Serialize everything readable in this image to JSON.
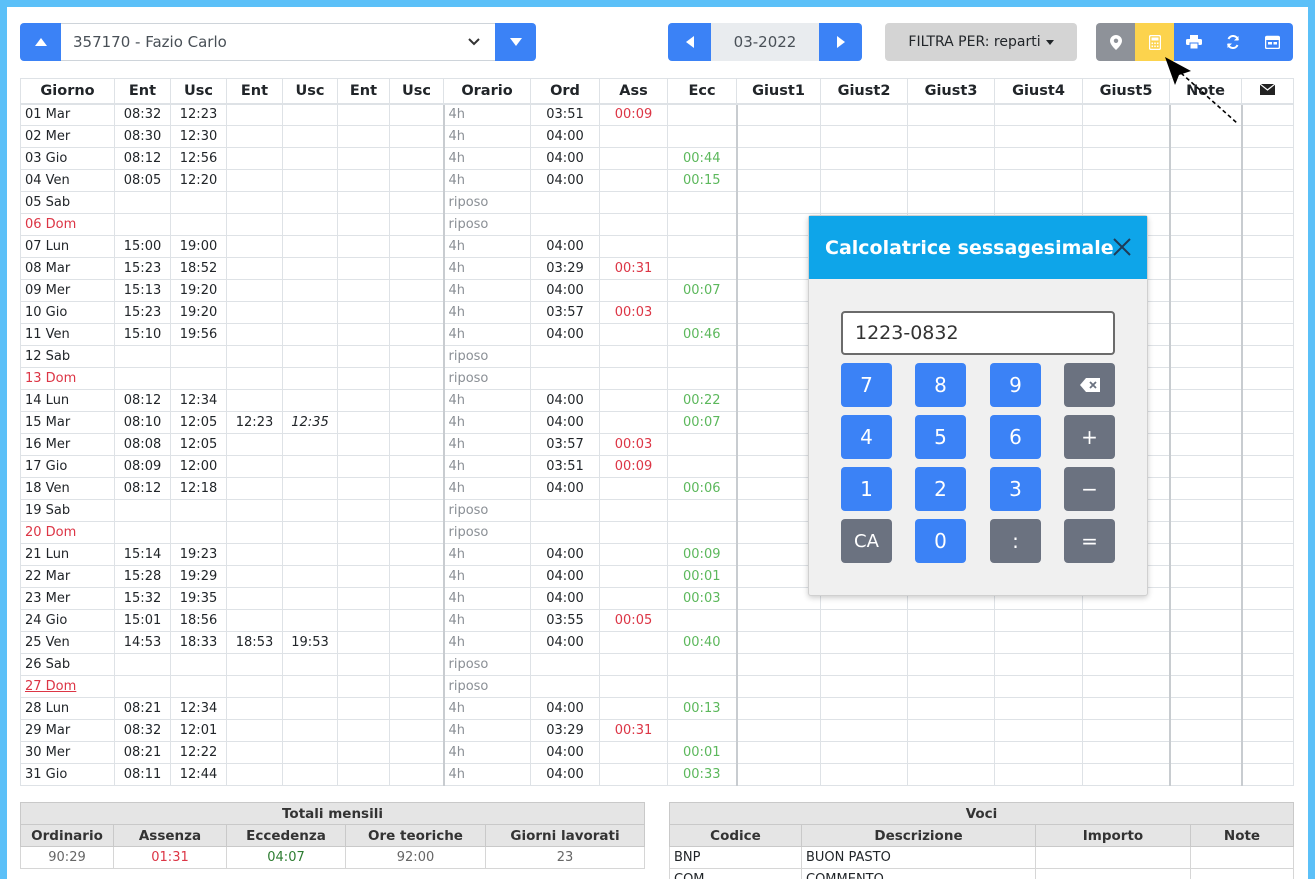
{
  "employee": {
    "label": "357170 - Fazio Carlo"
  },
  "month": {
    "value": "03-2022"
  },
  "filter": {
    "label": "FILTRA PER: reparti"
  },
  "colors": {
    "blue": "#3b82f6",
    "yellow": "#fcd34d",
    "calc_header": "#0ea5e9",
    "red": "#dc3545",
    "green": "#5cb85c"
  },
  "table": {
    "headers": [
      "Giorno",
      "Ent",
      "Usc",
      "Ent",
      "Usc",
      "Ent",
      "Usc",
      "Orario",
      "Ord",
      "Ass",
      "Ecc",
      "Giust1",
      "Giust2",
      "Giust3",
      "Giust4",
      "Giust5",
      "Note"
    ],
    "rows": [
      {
        "day": "01 Mar",
        "e1": "08:32",
        "u1": "12:23",
        "orario": "4h",
        "ord": "03:51",
        "ass": "00:09",
        "ecc": ""
      },
      {
        "day": "02 Mer",
        "e1": "08:30",
        "u1": "12:30",
        "orario": "4h",
        "ord": "04:00",
        "ass": "",
        "ecc": ""
      },
      {
        "day": "03 Gio",
        "e1": "08:12",
        "u1": "12:56",
        "orario": "4h",
        "ord": "04:00",
        "ass": "",
        "ecc": "00:44"
      },
      {
        "day": "04 Ven",
        "e1": "08:05",
        "u1": "12:20",
        "orario": "4h",
        "ord": "04:00",
        "ass": "",
        "ecc": "00:15"
      },
      {
        "day": "05 Sab",
        "orario": "riposo"
      },
      {
        "day": "06 Dom",
        "orario": "riposo",
        "sunday": true
      },
      {
        "day": "07 Lun",
        "e1": "15:00",
        "u1": "19:00",
        "orario": "4h",
        "ord": "04:00"
      },
      {
        "day": "08 Mar",
        "e1": "15:23",
        "u1": "18:52",
        "orario": "4h",
        "ord": "03:29",
        "ass": "00:31"
      },
      {
        "day": "09 Mer",
        "e1": "15:13",
        "u1": "19:20",
        "orario": "4h",
        "ord": "04:00",
        "ecc": "00:07"
      },
      {
        "day": "10 Gio",
        "e1": "15:23",
        "u1": "19:20",
        "orario": "4h",
        "ord": "03:57",
        "ass": "00:03"
      },
      {
        "day": "11 Ven",
        "e1": "15:10",
        "u1": "19:56",
        "orario": "4h",
        "ord": "04:00",
        "ecc": "00:46"
      },
      {
        "day": "12 Sab",
        "orario": "riposo"
      },
      {
        "day": "13 Dom",
        "orario": "riposo",
        "sunday": true
      },
      {
        "day": "14 Lun",
        "e1": "08:12",
        "u1": "12:34",
        "orario": "4h",
        "ord": "04:00",
        "ecc": "00:22"
      },
      {
        "day": "15 Mar",
        "e1": "08:10",
        "u1": "12:05",
        "e2": "12:23",
        "u2": "12:35",
        "orario": "4h",
        "ord": "04:00",
        "ecc": "00:07"
      },
      {
        "day": "16 Mer",
        "e1": "08:08",
        "u1": "12:05",
        "orario": "4h",
        "ord": "03:57",
        "ass": "00:03"
      },
      {
        "day": "17 Gio",
        "e1": "08:09",
        "u1": "12:00",
        "orario": "4h",
        "ord": "03:51",
        "ass": "00:09"
      },
      {
        "day": "18 Ven",
        "e1": "08:12",
        "u1": "12:18",
        "orario": "4h",
        "ord": "04:00",
        "ecc": "00:06"
      },
      {
        "day": "19 Sab",
        "orario": "riposo"
      },
      {
        "day": "20 Dom",
        "orario": "riposo",
        "sunday": true
      },
      {
        "day": "21 Lun",
        "e1": "15:14",
        "u1": "19:23",
        "orario": "4h",
        "ord": "04:00",
        "ecc": "00:09"
      },
      {
        "day": "22 Mar",
        "e1": "15:28",
        "u1": "19:29",
        "orario": "4h",
        "ord": "04:00",
        "ecc": "00:01"
      },
      {
        "day": "23 Mer",
        "e1": "15:32",
        "u1": "19:35",
        "orario": "4h",
        "ord": "04:00",
        "ecc": "00:03"
      },
      {
        "day": "24 Gio",
        "e1": "15:01",
        "u1": "18:56",
        "orario": "4h",
        "ord": "03:55",
        "ass": "00:05"
      },
      {
        "day": "25 Ven",
        "e1": "14:53",
        "u1": "18:33",
        "e2": "18:53",
        "u2": "19:53",
        "orario": "4h",
        "ord": "04:00",
        "ecc": "00:40"
      },
      {
        "day": "26 Sab",
        "orario": "riposo"
      },
      {
        "day": "27 Dom",
        "orario": "riposo",
        "sunday": true,
        "link": true
      },
      {
        "day": "28 Lun",
        "e1": "08:21",
        "u1": "12:34",
        "orario": "4h",
        "ord": "04:00",
        "ecc": "00:13"
      },
      {
        "day": "29 Mar",
        "e1": "08:32",
        "u1": "12:01",
        "orario": "4h",
        "ord": "03:29",
        "ass": "00:31"
      },
      {
        "day": "30 Mer",
        "e1": "08:21",
        "u1": "12:22",
        "orario": "4h",
        "ord": "04:00",
        "ecc": "00:01"
      },
      {
        "day": "31 Gio",
        "e1": "08:11",
        "u1": "12:44",
        "orario": "4h",
        "ord": "04:00",
        "ecc": "00:33"
      }
    ]
  },
  "totals": {
    "title": "Totali mensili",
    "headers": [
      "Ordinario",
      "Assenza",
      "Eccedenza",
      "Ore teoriche",
      "Giorni lavorati"
    ],
    "values": [
      "90:29",
      "01:31",
      "04:07",
      "92:00",
      "23"
    ]
  },
  "voci": {
    "title": "Voci",
    "headers": [
      "Codice",
      "Descrizione",
      "Importo",
      "Note"
    ],
    "rows": [
      [
        "BNP",
        "BUON PASTO",
        "",
        ""
      ],
      [
        "COM",
        "COMMENTO",
        "",
        ""
      ]
    ]
  },
  "calculator": {
    "title": "Calcolatrice sessagesimale",
    "display": "1223-0832",
    "keys": [
      "7",
      "8",
      "9",
      "⌫",
      "4",
      "5",
      "6",
      "+",
      "1",
      "2",
      "3",
      "−",
      "CA",
      "0",
      ":",
      "="
    ]
  }
}
